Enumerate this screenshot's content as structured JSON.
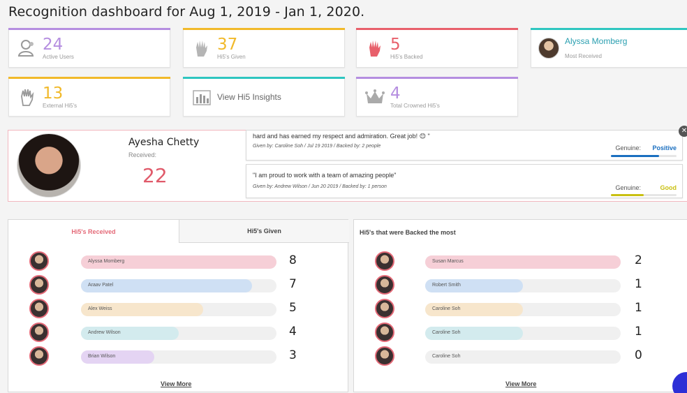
{
  "page": {
    "title": "Recognition dashboard for Aug 1, 2019 - Jan 1, 2020."
  },
  "colors": {
    "purple": "#b58ee0",
    "gold": "#f1b92a",
    "red": "#e8606b",
    "teal": "#2fc6c0",
    "accent_pink": "#e46a78",
    "positive": "#1a6fc0",
    "good": "#c9c012"
  },
  "stats": [
    {
      "id": "active-users",
      "value": "24",
      "label": "Active Users",
      "icon": "users-icon",
      "color": "#b58ee0"
    },
    {
      "id": "hi5s-given",
      "value": "37",
      "label": "Hi5's Given",
      "icon": "hand-icon",
      "color": "#f1b92a"
    },
    {
      "id": "hi5s-backed",
      "value": "5",
      "label": "Hi5's Backed",
      "icon": "raised-hand-icon",
      "color": "#e8606b"
    },
    {
      "id": "most-received",
      "value": "Alyssa Momberg",
      "label": "Most Received",
      "icon": "avatar",
      "color": "#2fc6c0"
    },
    {
      "id": "external-hi5s",
      "value": "13",
      "label": "External Hi5's",
      "icon": "hand-outline-icon",
      "color": "#f1b92a"
    },
    {
      "id": "hi5-insights",
      "value": "View Hi5 Insights",
      "label": "",
      "icon": "bar-chart-icon",
      "color": "#2fc6c0"
    },
    {
      "id": "crowned-hi5s",
      "value": "4",
      "label": "Total Crowned Hi5's",
      "icon": "crown-icon",
      "color": "#b58ee0"
    }
  ],
  "featured": {
    "name": "Ayesha Chetty",
    "received_label": "Received:",
    "received_count": "22",
    "messages": [
      {
        "text": "hard and has earned my respect and admiration. Great job! 😊 \"",
        "meta": "Given by: Caroline Soh / Jul 19 2019 / Backed by: 2 people",
        "genuine_label": "Genuine:",
        "genuine_value": "Positive",
        "genuine_level": 0.73,
        "color": "#1a6fc0"
      },
      {
        "text": "\"I am proud to work with a team of amazing people\"",
        "meta": "Given by: Andrew Wilson / Jun 20 2019 / Backed by: 1 person",
        "genuine_label": "Genuine:",
        "genuine_value": "Good",
        "genuine_level": 0.5,
        "color": "#c9c012"
      }
    ]
  },
  "received_panel": {
    "tabs": [
      "Hi5's Received",
      "Hi5's Given"
    ],
    "rows": [
      {
        "name": "Alyssa Momberg",
        "count": "8",
        "level": 1.0,
        "color": "#f6cfd7"
      },
      {
        "name": "Araav Patel",
        "count": "7",
        "level": 0.875,
        "color": "#cfe0f4"
      },
      {
        "name": "Alex Weiss",
        "count": "5",
        "level": 0.625,
        "color": "#f7e6cc"
      },
      {
        "name": "Andrew Wilson",
        "count": "4",
        "level": 0.5,
        "color": "#d3ebee"
      },
      {
        "name": "Brian Wilson",
        "count": "3",
        "level": 0.375,
        "color": "#e4d4f3"
      }
    ],
    "view_more": "View More"
  },
  "backed_panel": {
    "title": "Hi5's that were Backed the most",
    "rows": [
      {
        "name": "Susan Marcus",
        "count": "2",
        "level": 1.0,
        "color": "#f6cfd7"
      },
      {
        "name": "Robert Smith",
        "count": "1",
        "level": 0.5,
        "color": "#cfe0f4"
      },
      {
        "name": "Caroline Soh",
        "count": "1",
        "level": 0.5,
        "color": "#f7e6cc"
      },
      {
        "name": "Caroline Soh",
        "count": "1",
        "level": 0.5,
        "color": "#d3ebee"
      },
      {
        "name": "Caroline Soh",
        "count": "0",
        "level": 0.0,
        "color": "#f0f0f0"
      }
    ],
    "view_more": "View More"
  }
}
